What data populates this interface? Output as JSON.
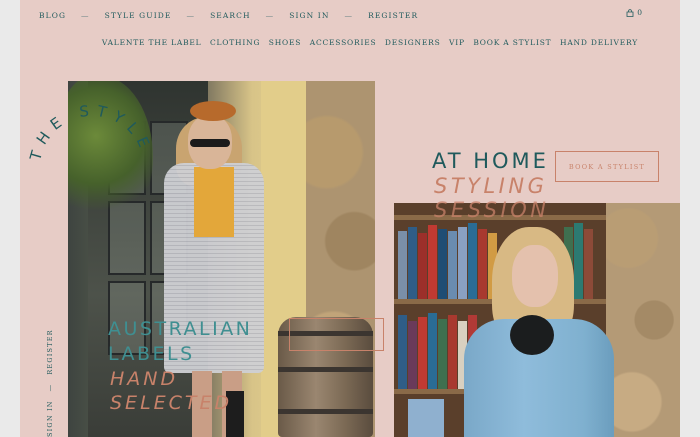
{
  "top_nav": {
    "items": [
      "BLOG",
      "STYLE GUIDE",
      "SEARCH",
      "SIGN IN",
      "REGISTER"
    ],
    "separator": "—"
  },
  "cart": {
    "count": "0"
  },
  "main_nav": {
    "items": [
      "VALENTE THE LABEL",
      "CLOTHING",
      "SHOES",
      "ACCESSORIES",
      "DESIGNERS",
      "VIP",
      "BOOK A STYLIST",
      "HAND DELIVERY"
    ]
  },
  "hero": {
    "line1": "AT HOME",
    "line2": "STYLING",
    "line3": "SESSION",
    "button": "BOOK A STYLIST"
  },
  "feature": {
    "line1": "AUSTRALIAN",
    "line2": "LABELS",
    "line3": "HAND",
    "line4": "SELECTED"
  },
  "circular": {
    "text": "THE STYLE"
  },
  "side_nav": {
    "items": [
      "SIGN IN",
      "—",
      "REGISTER"
    ]
  },
  "colors": {
    "background": "#e7ccc6",
    "teal": "#1f5a5c",
    "terracotta": "#c8826a"
  },
  "icons": {
    "cart": "bag-icon"
  }
}
